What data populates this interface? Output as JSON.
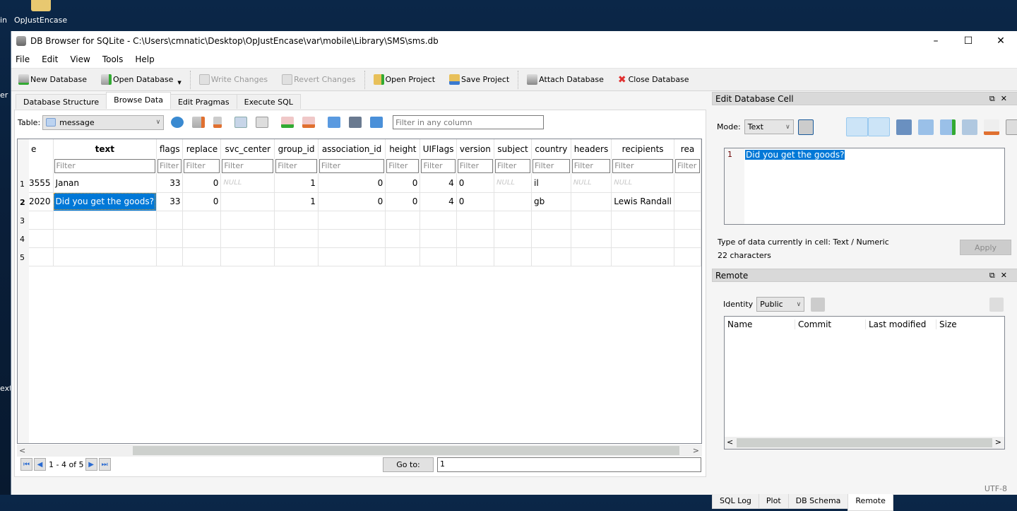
{
  "desktop": {
    "folder_label": "OpJustEncase",
    "left_fragments": [
      "in",
      "er",
      "ext"
    ]
  },
  "window": {
    "title": "DB Browser for SQLite - C:\\Users\\cmnatic\\Desktop\\OpJustEncase\\var\\mobile\\Library\\SMS\\sms.db",
    "controls": {
      "minimize": "–",
      "maximize": "☐",
      "close": "✕"
    }
  },
  "menu": [
    "File",
    "Edit",
    "View",
    "Tools",
    "Help"
  ],
  "toolbar": {
    "new_database": "New Database",
    "open_database": "Open Database",
    "write_changes": "Write Changes",
    "revert_changes": "Revert Changes",
    "open_project": "Open Project",
    "save_project": "Save Project",
    "attach_database": "Attach Database",
    "close_database": "Close Database"
  },
  "tabs": [
    "Database Structure",
    "Browse Data",
    "Edit Pragmas",
    "Execute SQL"
  ],
  "active_tab": "Browse Data",
  "browse": {
    "table_label": "Table:",
    "table_value": "message",
    "filter_placeholder": "Filter in any column",
    "columns": [
      "e",
      "text",
      "flags",
      "replace",
      "svc_center",
      "group_id",
      "association_id",
      "height",
      "UIFlags",
      "version",
      "subject",
      "country",
      "headers",
      "recipients",
      "rea"
    ],
    "filter_placeholder_cell": "Filter",
    "null_label": "NULL",
    "rows": [
      {
        "num": "1",
        "cells": [
          "3555",
          "Janan",
          "33",
          "0",
          "NULL",
          "1",
          "0",
          "0",
          "4",
          "0",
          "NULL",
          "il",
          "NULL",
          "NULL",
          ""
        ]
      },
      {
        "num": "2",
        "cells": [
          "2020",
          "Did you get the goods?",
          "33",
          "0",
          "",
          "1",
          "0",
          "0",
          "4",
          "0",
          "",
          "gb",
          "",
          "Lewis Randall",
          ""
        ]
      },
      {
        "num": "3",
        "cells": [
          "",
          "",
          "",
          "",
          "",
          "",
          "",
          "",
          "",
          "",
          "",
          "",
          "",
          "",
          ""
        ]
      },
      {
        "num": "4",
        "cells": [
          "",
          "",
          "",
          "",
          "",
          "",
          "",
          "",
          "",
          "",
          "",
          "",
          "",
          "",
          ""
        ]
      },
      {
        "num": "5",
        "cells": [
          "",
          "",
          "",
          "",
          "",
          "",
          "",
          "",
          "",
          "",
          "",
          "",
          "",
          "",
          ""
        ]
      }
    ],
    "pager_text": "1 - 4 of 5",
    "goto_label": "Go to:",
    "goto_value": "1"
  },
  "edit_cell": {
    "title": "Edit Database Cell",
    "mode_label": "Mode:",
    "mode_value": "Text",
    "line_number": "1",
    "content": "Did you get the goods?",
    "type_info": "Type of data currently in cell: Text / Numeric",
    "char_count": "22 characters",
    "apply_label": "Apply"
  },
  "remote": {
    "title": "Remote",
    "identity_label": "Identity",
    "identity_value": "Public",
    "columns": [
      "Name",
      "Commit",
      "Last modified",
      "Size"
    ]
  },
  "bottom_tabs": [
    "SQL Log",
    "Plot",
    "DB Schema",
    "Remote"
  ],
  "bottom_active": "Remote",
  "status": {
    "encoding": "UTF-8"
  },
  "colors": {
    "selection": "#0078d7",
    "accent_icon": "#2a6bd1",
    "close_icon": "#e03030"
  }
}
